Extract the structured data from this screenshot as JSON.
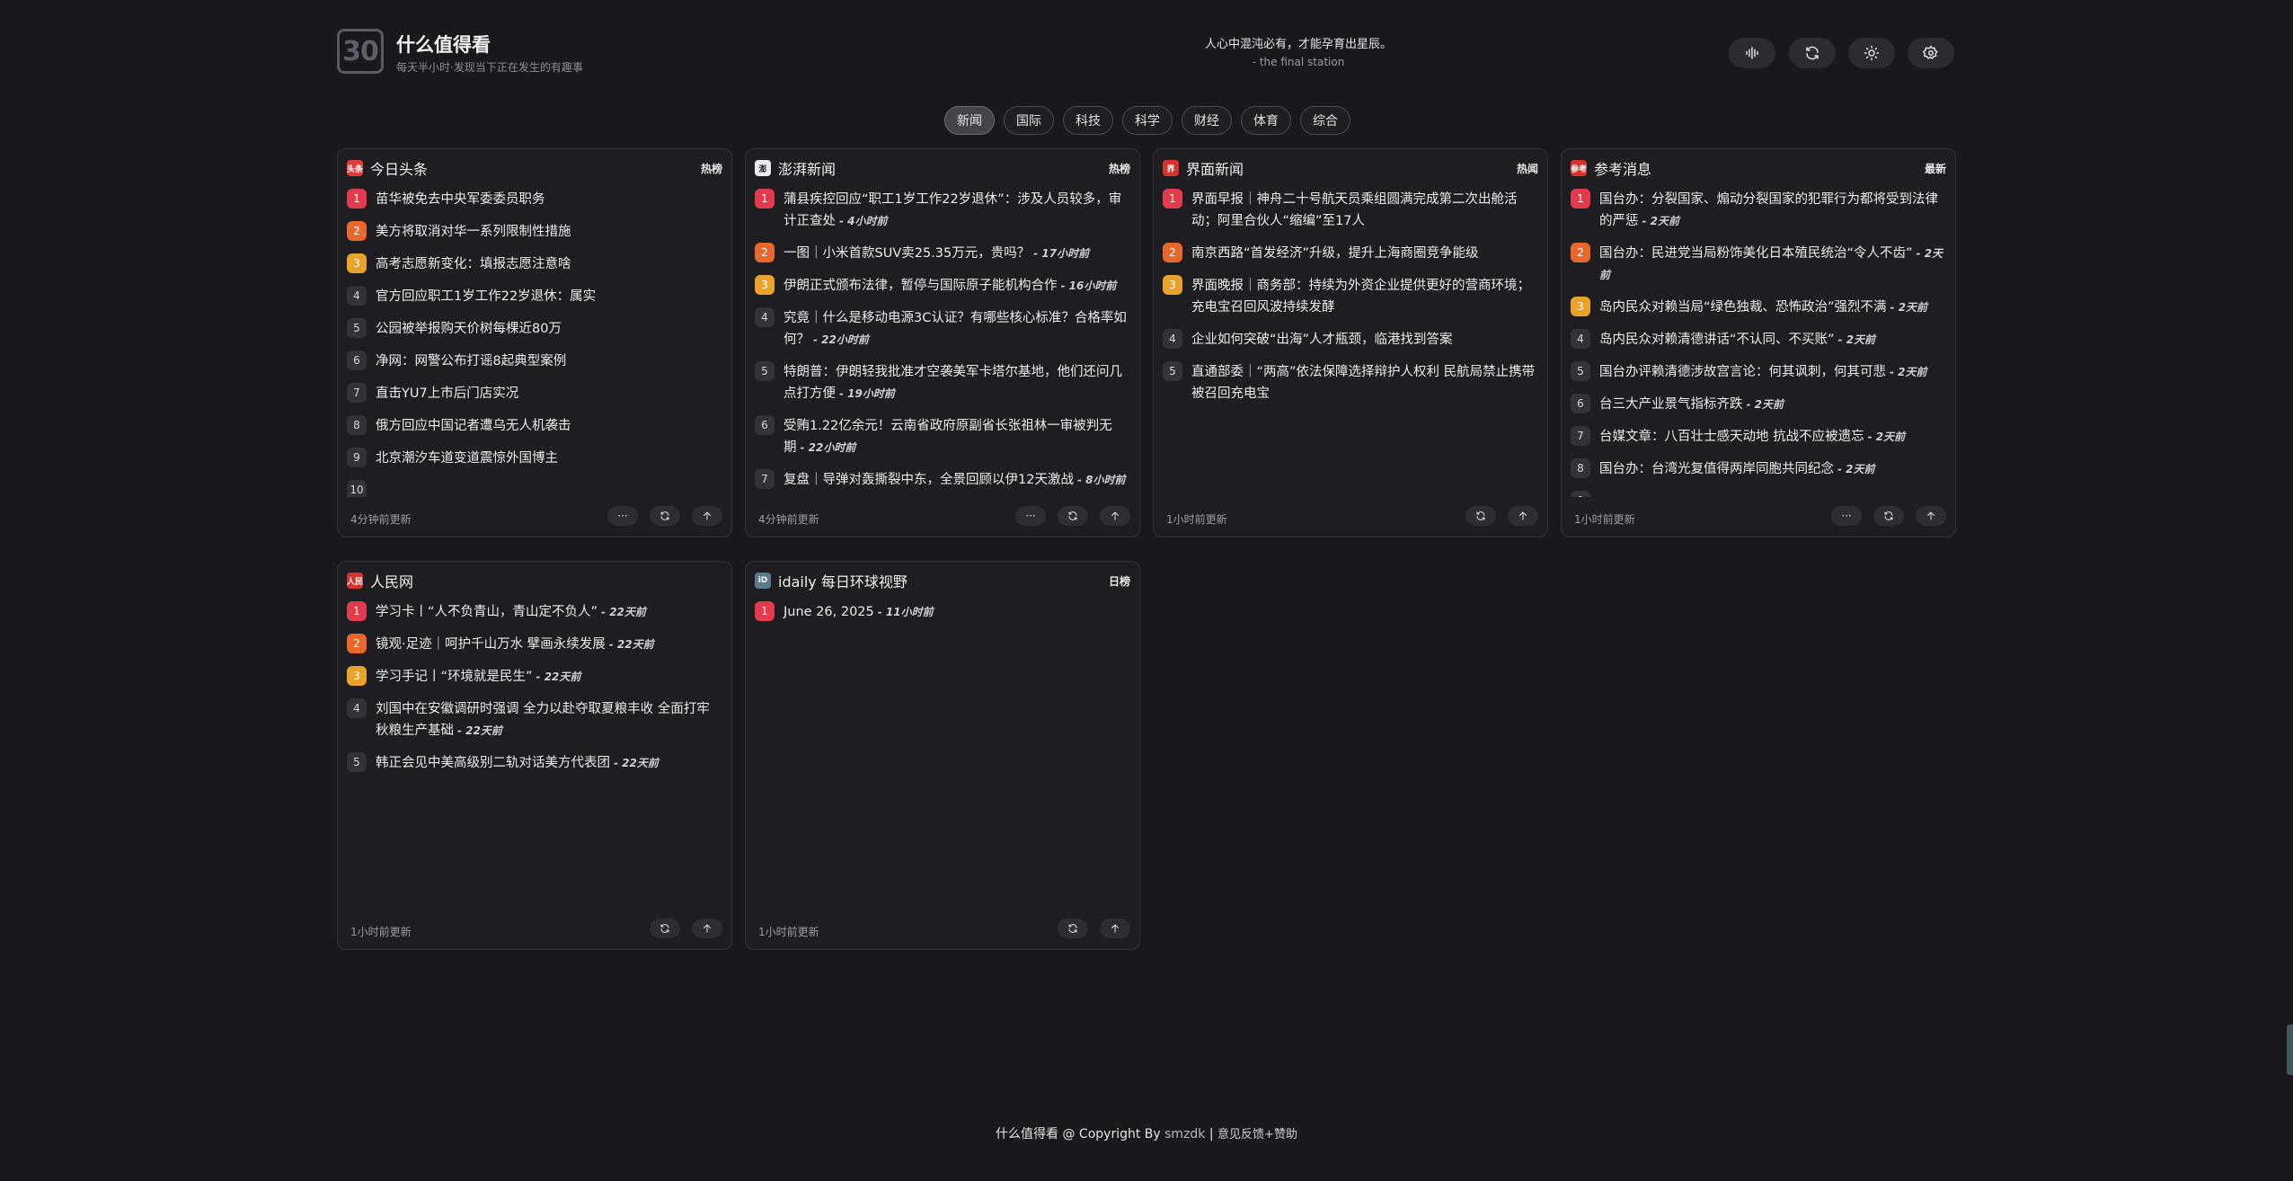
{
  "header": {
    "logo_text": "30",
    "title": "什么值得看",
    "subtitle": "每天半小时·发现当下正在发生的有趣事",
    "slogan": "人心中混沌必有，才能孕育出星辰。",
    "slogan_sub": "- the final station",
    "buttons": [
      "sound-wave-icon",
      "refresh-icon",
      "sun-icon",
      "gear-icon"
    ]
  },
  "tabs": [
    {
      "label": "新闻",
      "active": true
    },
    {
      "label": "国际",
      "active": false
    },
    {
      "label": "科技",
      "active": false
    },
    {
      "label": "科学",
      "active": false
    },
    {
      "label": "财经",
      "active": false
    },
    {
      "label": "体育",
      "active": false
    },
    {
      "label": "综合",
      "active": false
    }
  ],
  "cards": [
    {
      "name": "今日头条",
      "type": "热榜",
      "icon_color": "#e23b3b",
      "icon_text": "头条",
      "updated": "4分钟前更新",
      "has_more": true,
      "items": [
        {
          "text": "苗华被免去中央军委委员职务",
          "time": ""
        },
        {
          "text": "美方将取消对华一系列限制性措施",
          "time": ""
        },
        {
          "text": "高考志愿新变化：填报志愿注意啥",
          "time": ""
        },
        {
          "text": "官方回应职工1岁工作22岁退休：属实",
          "time": ""
        },
        {
          "text": "公园被举报购天价树每棵近80万",
          "time": ""
        },
        {
          "text": "净网：网警公布打谣8起典型案例",
          "time": ""
        },
        {
          "text": "直击YU7上市后门店实况",
          "time": ""
        },
        {
          "text": "俄方回应中国记者遭乌无人机袭击",
          "time": ""
        },
        {
          "text": "北京潮汐车道变道震惊外国博主",
          "time": ""
        },
        {
          "text": "",
          "time": ""
        }
      ]
    },
    {
      "name": "澎湃新闻",
      "type": "热榜",
      "icon_color": "#ececec",
      "icon_text": "澎",
      "updated": "4分钟前更新",
      "has_more": true,
      "items": [
        {
          "text": "蒲县疾控回应“职工1岁工作22岁退休”：涉及人员较多，审计正查处",
          "time": "- 4小时前"
        },
        {
          "text": "一图｜小米首款SUV卖25.35万元，贵吗？",
          "time": "- 17小时前"
        },
        {
          "text": "伊朗正式颁布法律，暂停与国际原子能机构合作",
          "time": "- 16小时前"
        },
        {
          "text": "究竟｜什么是移动电源3C认证？有哪些核心标准？合格率如何？",
          "time": "- 22小时前"
        },
        {
          "text": "特朗普：伊朗轻我批准才空袭美军卡塔尔基地，他们还问几点打方便",
          "time": "- 19小时前"
        },
        {
          "text": "受贿1.22亿余元！云南省政府原副省长张祖林一审被判无期",
          "time": "- 22小时前"
        },
        {
          "text": "复盘｜导弹对轰撕裂中东，全景回顾以伊12天激战",
          "time": "- 8小时前"
        }
      ]
    },
    {
      "name": "界面新闻",
      "type": "热闻",
      "icon_color": "#d8332b",
      "icon_text": "界",
      "updated": "1小时前更新",
      "has_more": false,
      "items": [
        {
          "text": "界面早报｜神舟二十号航天员乘组圆满完成第二次出舱活动；阿里合伙人“缩编”至17人",
          "time": ""
        },
        {
          "text": "南京西路“首发经济”升级，提升上海商圈竞争能级",
          "time": ""
        },
        {
          "text": "界面晚报｜商务部：持续为外资企业提供更好的营商环境；充电宝召回风波持续发酵",
          "time": ""
        },
        {
          "text": "企业如何突破“出海”人才瓶颈，临港找到答案",
          "time": ""
        },
        {
          "text": "直通部委｜“两高”依法保障选择辩护人权利 民航局禁止携带被召回充电宝",
          "time": ""
        }
      ]
    },
    {
      "name": "参考消息",
      "type": "最新",
      "icon_color": "#d8332b",
      "icon_text": "参考",
      "updated": "1小时前更新",
      "has_more": true,
      "items": [
        {
          "text": "国台办：分裂国家、煽动分裂国家的犯罪行为都将受到法律的严惩",
          "time": "- 2天前"
        },
        {
          "text": "国台办：民进党当局粉饰美化日本殖民统治“令人不齿”",
          "time": "- 2天前"
        },
        {
          "text": "岛内民众对赖当局“绿色独裁、恐怖政治”强烈不满",
          "time": "- 2天前"
        },
        {
          "text": "岛内民众对赖清德讲话“不认同、不买账”",
          "time": "- 2天前"
        },
        {
          "text": "国台办评赖清德涉故宫言论：何其讽刺，何其可悲",
          "time": "- 2天前"
        },
        {
          "text": "台三大产业景气指标齐跌",
          "time": "- 2天前"
        },
        {
          "text": "台媒文章：八百壮士感天动地 抗战不应被遗忘",
          "time": "- 2天前"
        },
        {
          "text": "国台办：台湾光复值得两岸同胞共同纪念",
          "time": "- 2天前"
        },
        {
          "text": "",
          "time": ""
        }
      ]
    },
    {
      "name": "人民网",
      "type": "",
      "icon_color": "#d8332b",
      "icon_text": "人民",
      "updated": "1小时前更新",
      "has_more": false,
      "items": [
        {
          "text": "学习卡丨“人不负青山，青山定不负人”",
          "time": "- 22天前"
        },
        {
          "text": "镜观·足迹｜呵护千山万水 擘画永续发展",
          "time": "- 22天前"
        },
        {
          "text": "学习手记丨“环境就是民生”",
          "time": "- 22天前"
        },
        {
          "text": "刘国中在安徽调研时强调 全力以赴夺取夏粮丰收 全面打牢秋粮生产基础",
          "time": "- 22天前"
        },
        {
          "text": "韩正会见中美高级别二轨对话美方代表团",
          "time": "- 22天前"
        }
      ]
    },
    {
      "name": "idaily 每日环球视野",
      "type": "日榜",
      "icon_color": "#5b7b8a",
      "icon_text": "iD",
      "updated": "1小时前更新",
      "has_more": false,
      "items": [
        {
          "text": "June 26, 2025",
          "time": "- 11小时前"
        }
      ]
    }
  ],
  "footer": {
    "title": "什么值得看",
    "copyright": " @ Copyright By ",
    "author": "smzdk",
    "sep": " | ",
    "feedback": "意见反馈+赞助"
  }
}
